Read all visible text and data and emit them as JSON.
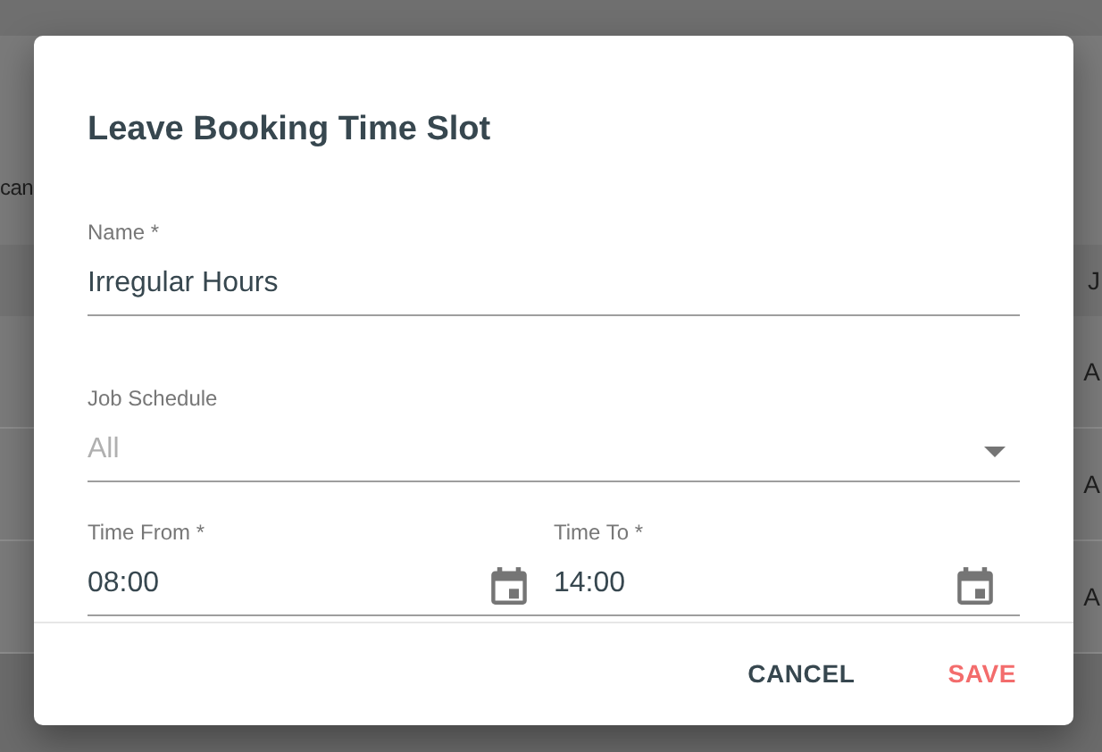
{
  "background": {
    "toolbar_text": "can",
    "table_header": "J",
    "table_rows": [
      "A",
      "A",
      "A"
    ]
  },
  "dialog": {
    "title": "Leave Booking Time Slot",
    "fields": [
      {
        "kind": "text",
        "label": "Name *",
        "value": "Irregular Hours"
      },
      {
        "kind": "select",
        "label": "Job Schedule",
        "placeholder": "All"
      },
      {
        "kind": "time",
        "label": "Time From *",
        "value": "08:00"
      },
      {
        "kind": "time",
        "label": "Time To *",
        "value": "14:00"
      }
    ],
    "buttons": [
      {
        "label": "CANCEL",
        "kind": "secondary"
      },
      {
        "label": "SAVE",
        "kind": "primary"
      }
    ]
  }
}
